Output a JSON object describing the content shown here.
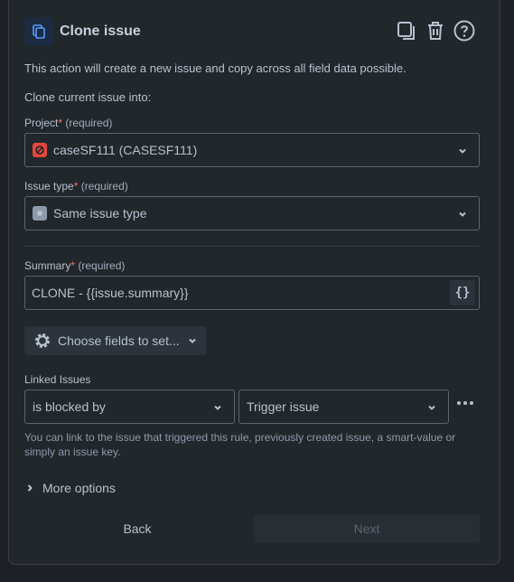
{
  "header": {
    "title": "Clone issue"
  },
  "description": "This action will create a new issue and copy across all field data possible.",
  "clone_into_label": "Clone current issue into:",
  "project": {
    "label": "Project",
    "required_mark": "*",
    "required_text": "(required)",
    "value": "caseSF111 (CASESF111)"
  },
  "issue_type": {
    "label": "Issue type",
    "required_mark": "*",
    "required_text": "(required)",
    "value": "Same issue type"
  },
  "summary": {
    "label": "Summary",
    "required_mark": "*",
    "required_text": "(required)",
    "value": "CLONE - {{issue.summary}}",
    "smart_value_button": "{}"
  },
  "choose_fields_label": "Choose fields to set...",
  "linked_issues": {
    "label": "Linked Issues",
    "relation_value": "is blocked by",
    "target_value": "Trigger issue",
    "more_icon": "ellipsis-icon",
    "hint": "You can link to the issue that triggered this rule, previously created issue, a smart-value or simply an issue key."
  },
  "more_options_label": "More options",
  "footer": {
    "back_label": "Back",
    "next_label": "Next"
  },
  "colors": {
    "accent": "#579dff",
    "required": "#f87168",
    "panel_bg": "#22272b"
  }
}
